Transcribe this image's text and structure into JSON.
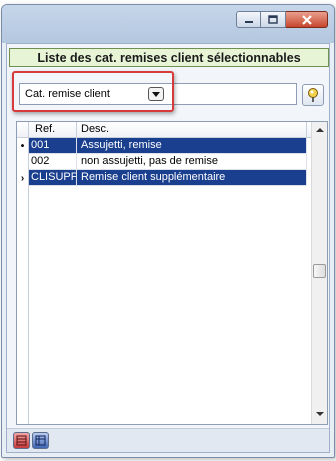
{
  "window": {
    "controls": [
      "minimize-icon",
      "maximize-icon",
      "close-icon"
    ]
  },
  "header": {
    "title": "Liste des cat. remises client sélectionnables"
  },
  "filter": {
    "combo_value": "Cat. remise client",
    "search_value": ""
  },
  "grid": {
    "columns": [
      "Ref.",
      "Desc."
    ],
    "rows": [
      {
        "indicator": "•",
        "ref": "001",
        "desc": "Assujetti, remise",
        "selected": true
      },
      {
        "indicator": "",
        "ref": "002",
        "desc": "non assujetti, pas de remise",
        "selected": false
      },
      {
        "indicator": "›",
        "ref": "CLISUPP",
        "desc": "Remise client supplémentaire",
        "selected": true
      }
    ]
  },
  "colors": {
    "selection": "#1a3f8f",
    "header_bg": "#e8f4d6",
    "highlight": "#d63a3a"
  },
  "footer": {
    "buttons": [
      "red-view-icon",
      "blue-view-icon"
    ]
  }
}
